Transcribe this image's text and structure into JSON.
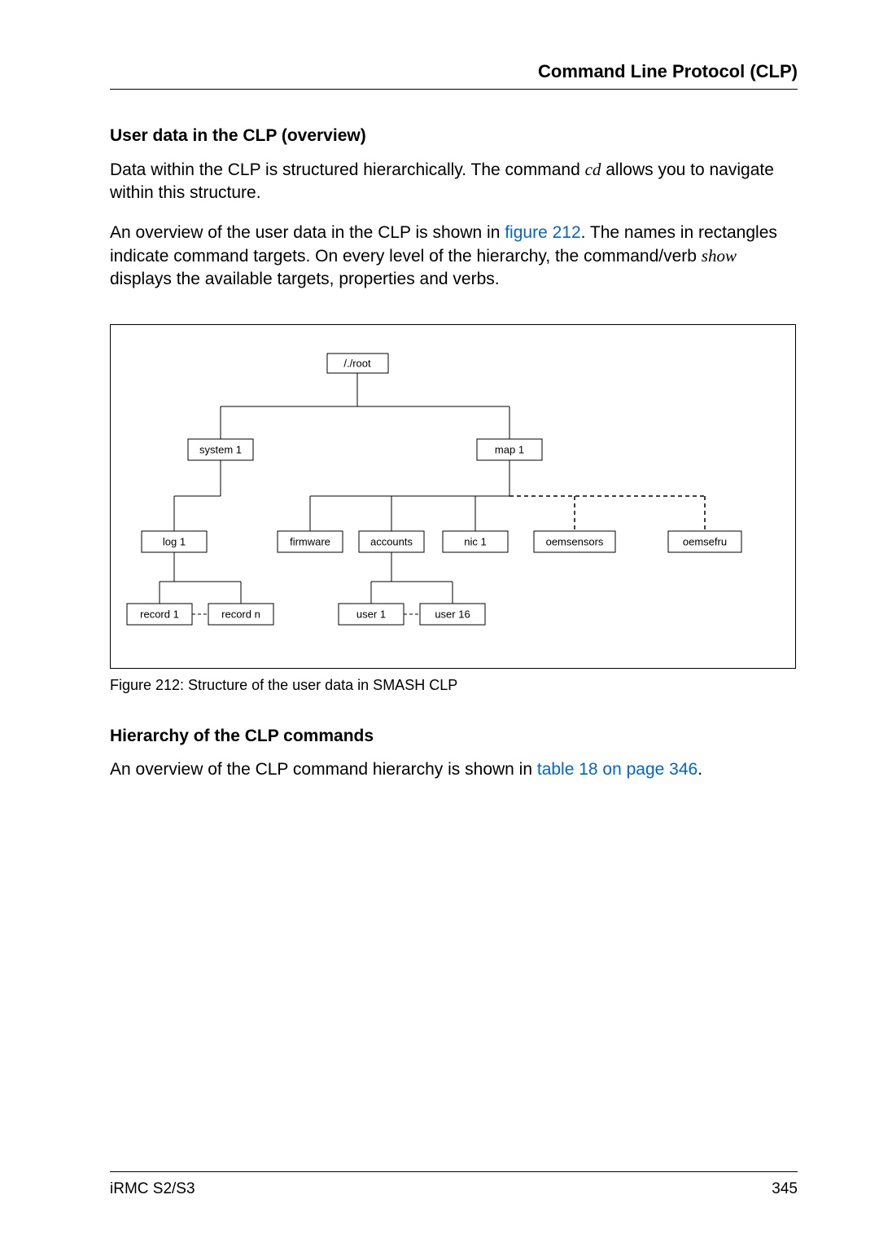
{
  "header": {
    "title": "Command Line Protocol (CLP)"
  },
  "section1": {
    "heading": "User data in the CLP (overview)",
    "p1a": "Data within the CLP is structured hierarchically. The command ",
    "p1_cmd": "cd",
    "p1b": " allows you to navigate within this structure.",
    "p2a": "An overview of the user data in the CLP is shown in ",
    "p2_link": "figure 212",
    "p2b": ". The names in rectangles indicate command targets. On every level of the hierarchy, the command/verb ",
    "p2_cmd": "show",
    "p2c": " displays the available targets, properties and verbs."
  },
  "diagram": {
    "nodes": {
      "root": "/./root",
      "system1": "system 1",
      "map1": "map 1",
      "log1": "log 1",
      "firmware": "firmware",
      "accounts": "accounts",
      "nic1": "nic 1",
      "oemsensors": "oemsensors",
      "oemsefru": "oemsefru",
      "record1": "record 1",
      "recordn": "record n",
      "user1": "user 1",
      "user16": "user 16"
    }
  },
  "figure_caption": "Figure 212: Structure of the user data in SMASH CLP",
  "section2": {
    "heading": "Hierarchy of the CLP commands",
    "p1a": "An overview of the CLP command hierarchy is shown in ",
    "p1_link": "table 18 on page 346",
    "p1b": "."
  },
  "footer": {
    "left": "iRMC S2/S3",
    "right": "345"
  }
}
